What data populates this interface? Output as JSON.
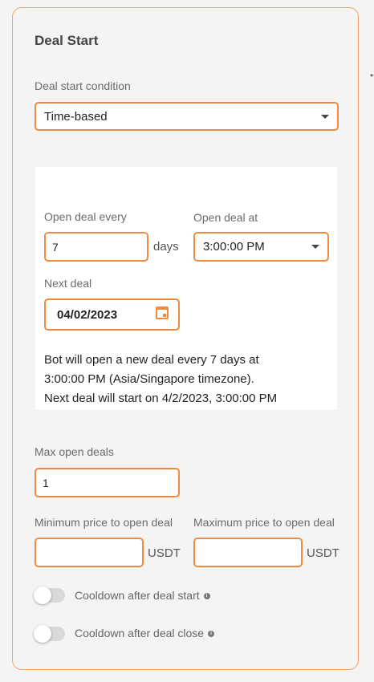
{
  "section": {
    "title": "Deal Start"
  },
  "deal_start_condition": {
    "label": "Deal start condition",
    "value": "Time-based"
  },
  "schedule": {
    "open_every_label": "Open deal every",
    "open_every_value": "7",
    "open_every_unit": "days",
    "open_at_label": "Open deal at",
    "open_at_value": "3:00:00 PM",
    "next_deal_label": "Next deal",
    "next_deal_value": "04/02/2023",
    "summary_line1": "Bot will open a new deal every 7 days at",
    "summary_line2": "3:00:00 PM (Asia/Singapore timezone).",
    "summary_line3": "Next deal will start on 4/2/2023, 3:00:00 PM"
  },
  "max_open_deals": {
    "label": "Max open deals",
    "value": "1"
  },
  "min_price": {
    "label": "Minimum price to open deal",
    "value": "",
    "unit": "USDT"
  },
  "max_price": {
    "label": "Maximum price to open deal",
    "value": "",
    "unit": "USDT"
  },
  "cooldown_start": {
    "label": "Cooldown after deal start",
    "enabled": false,
    "icon": "info-icon"
  },
  "cooldown_close": {
    "label": "Cooldown after deal close",
    "enabled": false,
    "icon": "info-icon"
  },
  "colors": {
    "accent": "#f08a3e",
    "card_border": "#f5a26a",
    "background": "#f4f4f4"
  }
}
